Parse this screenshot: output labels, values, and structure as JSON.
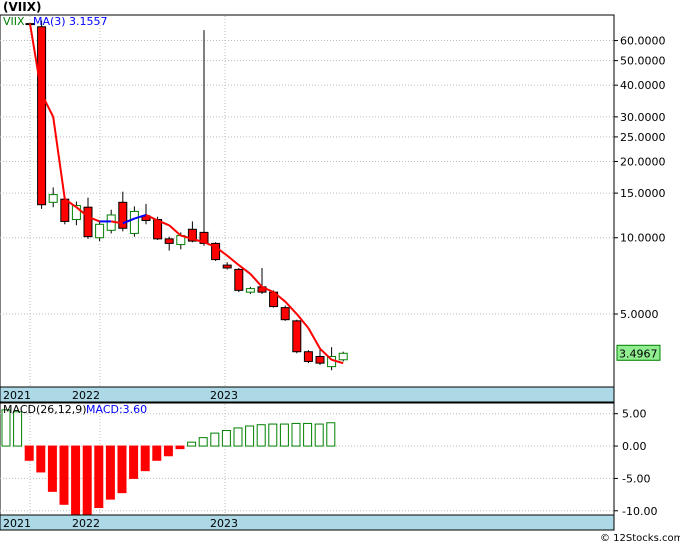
{
  "page_title": "(VIIX)",
  "watermark": "© 12Stocks.com",
  "chart_data": [
    {
      "type": "candlestick",
      "scale": "log",
      "legend": {
        "symbol": "VIIX",
        "ma_label": "MA(3)",
        "ma_value": "3.1557"
      },
      "last_price_label": "3.4967",
      "y_ticks": [
        "60.0000",
        "50.0000",
        "40.0000",
        "30.0000",
        "25.0000",
        "20.0000",
        "15.0000",
        "10.0000",
        "5.0000"
      ],
      "y_tick_values": [
        60,
        50,
        40,
        30,
        25,
        20,
        15,
        10,
        5
      ],
      "ylim": [
        2.6,
        75
      ],
      "x_labels": [
        "2021",
        "2022",
        "2023"
      ],
      "colors": {
        "up": "#008000",
        "down": "#ff0000",
        "ma_up": "#0000ff",
        "ma_down": "#ff0000",
        "axis_band": "#add8e6"
      },
      "candles": [
        {
          "o": 70,
          "h": 70,
          "l": 69,
          "c": 69.5
        },
        {
          "o": 68,
          "h": 72,
          "l": 13,
          "c": 13.5
        },
        {
          "o": 13.8,
          "h": 15.8,
          "l": 13.2,
          "c": 14.8
        },
        {
          "o": 14.2,
          "h": 14.5,
          "l": 11.3,
          "c": 11.6
        },
        {
          "o": 11.8,
          "h": 13.9,
          "l": 11.2,
          "c": 13.4
        },
        {
          "o": 13.2,
          "h": 14.4,
          "l": 9.9,
          "c": 10.1
        },
        {
          "o": 10.0,
          "h": 11.7,
          "l": 9.7,
          "c": 11.3
        },
        {
          "o": 10.7,
          "h": 12.9,
          "l": 10.4,
          "c": 12.3
        },
        {
          "o": 13.8,
          "h": 15.2,
          "l": 10.6,
          "c": 10.9
        },
        {
          "o": 10.4,
          "h": 13.3,
          "l": 10.1,
          "c": 12.7
        },
        {
          "o": 12.2,
          "h": 13.6,
          "l": 11.3,
          "c": 11.7
        },
        {
          "o": 11.8,
          "h": 12.1,
          "l": 9.8,
          "c": 9.9
        },
        {
          "o": 9.9,
          "h": 10.1,
          "l": 8.9,
          "c": 9.5
        },
        {
          "o": 9.4,
          "h": 10.5,
          "l": 9.0,
          "c": 10.2
        },
        {
          "o": 10.8,
          "h": 11.6,
          "l": 9.6,
          "c": 9.7
        },
        {
          "o": 10.5,
          "h": 66,
          "l": 9.3,
          "c": 9.5
        },
        {
          "o": 9.5,
          "h": 9.6,
          "l": 8.1,
          "c": 8.2
        },
        {
          "o": 7.8,
          "h": 8.0,
          "l": 7.5,
          "c": 7.6
        },
        {
          "o": 7.5,
          "h": 7.6,
          "l": 6.1,
          "c": 6.2
        },
        {
          "o": 6.1,
          "h": 6.4,
          "l": 6.0,
          "c": 6.3
        },
        {
          "o": 6.4,
          "h": 7.6,
          "l": 6.0,
          "c": 6.1
        },
        {
          "o": 6.1,
          "h": 6.2,
          "l": 5.3,
          "c": 5.35
        },
        {
          "o": 5.3,
          "h": 5.4,
          "l": 4.7,
          "c": 4.75
        },
        {
          "o": 4.7,
          "h": 4.75,
          "l": 3.5,
          "c": 3.55
        },
        {
          "o": 3.55,
          "h": 3.6,
          "l": 3.2,
          "c": 3.25
        },
        {
          "o": 3.4,
          "h": 3.7,
          "l": 3.15,
          "c": 3.2
        },
        {
          "o": 3.1,
          "h": 3.7,
          "l": 3.0,
          "c": 3.4
        },
        {
          "o": 3.3,
          "h": 3.55,
          "l": 3.25,
          "c": 3.5
        }
      ],
      "ma": [
        70,
        37,
        30,
        14.2,
        13.2,
        12.1,
        11.6,
        11.6,
        11.4,
        11.9,
        12.3,
        11.7,
        11.2,
        10.2,
        9.9,
        9.6,
        9.2,
        8.5,
        7.8,
        7.2,
        6.4,
        6.1,
        5.6,
        5.0,
        4.4,
        3.65,
        3.3,
        3.2
      ]
    },
    {
      "type": "bar",
      "legend": {
        "label": "MACD(26,12,9)",
        "value_label": "MACD:3.60"
      },
      "y_ticks": [
        "5.00",
        "0.00",
        "-5.00",
        "-10.00"
      ],
      "y_tick_values": [
        5,
        0,
        -5,
        -10
      ],
      "ylim": [
        -10.5,
        6.5
      ],
      "values": [
        5.6,
        5.3,
        -2.2,
        -4.0,
        -7.0,
        -9.0,
        -10.5,
        -10.5,
        -9.5,
        -8.2,
        -7.2,
        -5.0,
        -3.8,
        -2.2,
        -1.5,
        -0.4,
        0.6,
        1.3,
        2.0,
        2.4,
        2.8,
        3.1,
        3.3,
        3.4,
        3.4,
        3.5,
        3.5,
        3.4,
        3.6
      ]
    }
  ]
}
